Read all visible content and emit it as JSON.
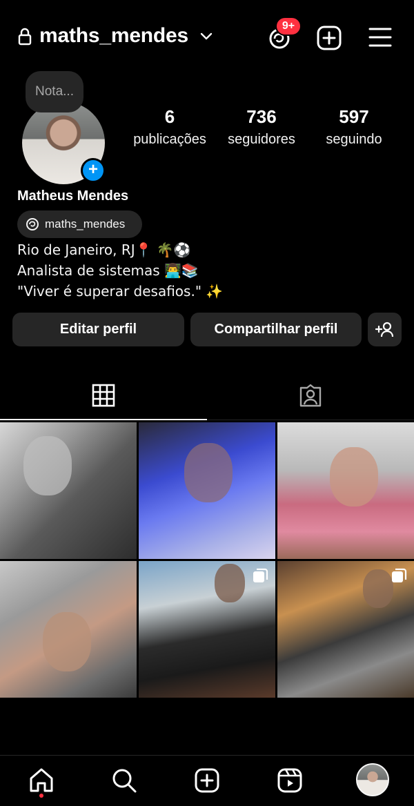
{
  "header": {
    "username": "maths_mendes",
    "notification_badge": "9+"
  },
  "profile": {
    "note_placeholder": "Nota...",
    "display_name": "Matheus Mendes",
    "threads_handle": "maths_mendes",
    "stats": [
      {
        "value": "6",
        "label": "publicações"
      },
      {
        "value": "736",
        "label": "seguidores"
      },
      {
        "value": "597",
        "label": "seguindo"
      }
    ],
    "bio": [
      "Rio de Janeiro, RJ📍 🌴⚽",
      "Analista de sistemas 👨‍💻📚",
      "\"Viver é superar desafios.\" ✨"
    ]
  },
  "actions": {
    "edit_label": "Editar perfil",
    "share_label": "Compartilhar perfil"
  },
  "tabs": [
    {
      "icon": "grid-icon",
      "active": true
    },
    {
      "icon": "tagged-icon",
      "active": false
    }
  ],
  "grid": [
    {
      "multi": false
    },
    {
      "multi": false
    },
    {
      "multi": false
    },
    {
      "multi": false
    },
    {
      "multi": true
    },
    {
      "multi": true
    }
  ],
  "bottom_nav": [
    "home-icon",
    "search-icon",
    "create-icon",
    "reels-icon",
    "profile-avatar"
  ],
  "colors": {
    "background": "#000000",
    "button_bg": "#262626",
    "accent_blue": "#0095f6",
    "badge_red": "#ff3040"
  }
}
